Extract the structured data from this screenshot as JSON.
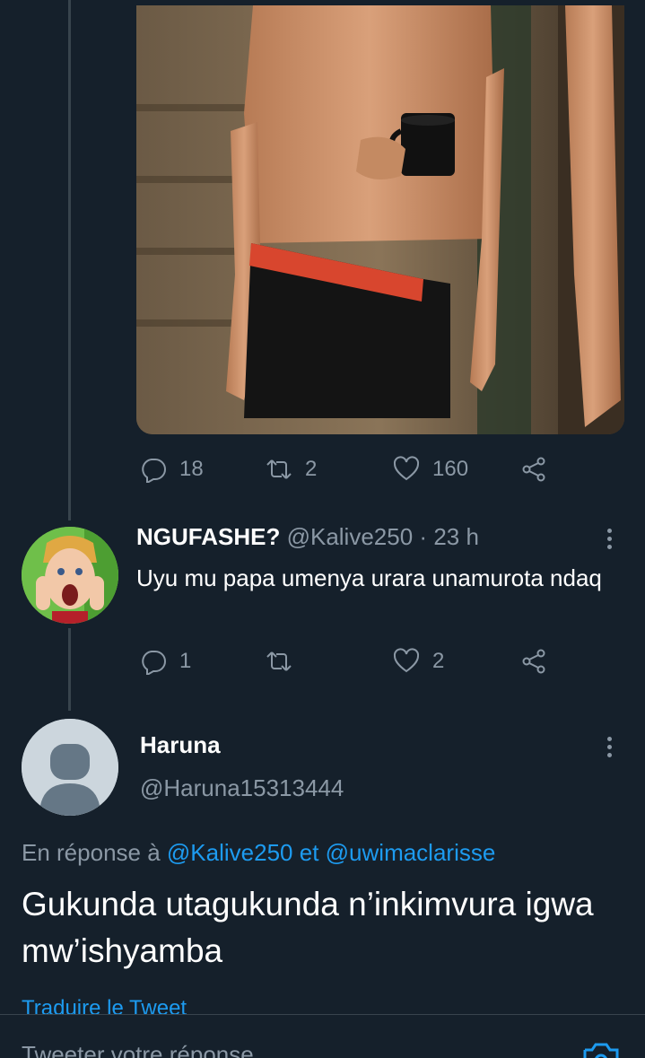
{
  "tweet_actions": {
    "replies": "18",
    "retweets": "2",
    "likes": "160"
  },
  "reply": {
    "name": "NGUFASHE?",
    "handle": "@Kalive250",
    "separator": "·",
    "time": "23 h",
    "text": "Uyu mu papa umenya urara unamurota ndaq",
    "replies": "1",
    "retweets": "",
    "likes": "2"
  },
  "main": {
    "name": "Haruna",
    "handle": "@Haruna15313444",
    "reply_prefix": "En réponse à",
    "reply_user1": "@Kalive250",
    "reply_conj": "et",
    "reply_user2": "@uwimaclarisse",
    "text": "Gukunda utagukunda n’inkimvura igwa mw’ishyamba",
    "translate": "Traduire le Tweet"
  },
  "composer": {
    "placeholder": "Tweeter votre réponse"
  },
  "icons": [
    "reply-icon",
    "retweet-icon",
    "like-icon",
    "share-icon",
    "more-icon",
    "camera-icon"
  ],
  "colors": {
    "background": "#15202b",
    "accent": "#1d9bf0",
    "muted": "#8b98a5"
  }
}
